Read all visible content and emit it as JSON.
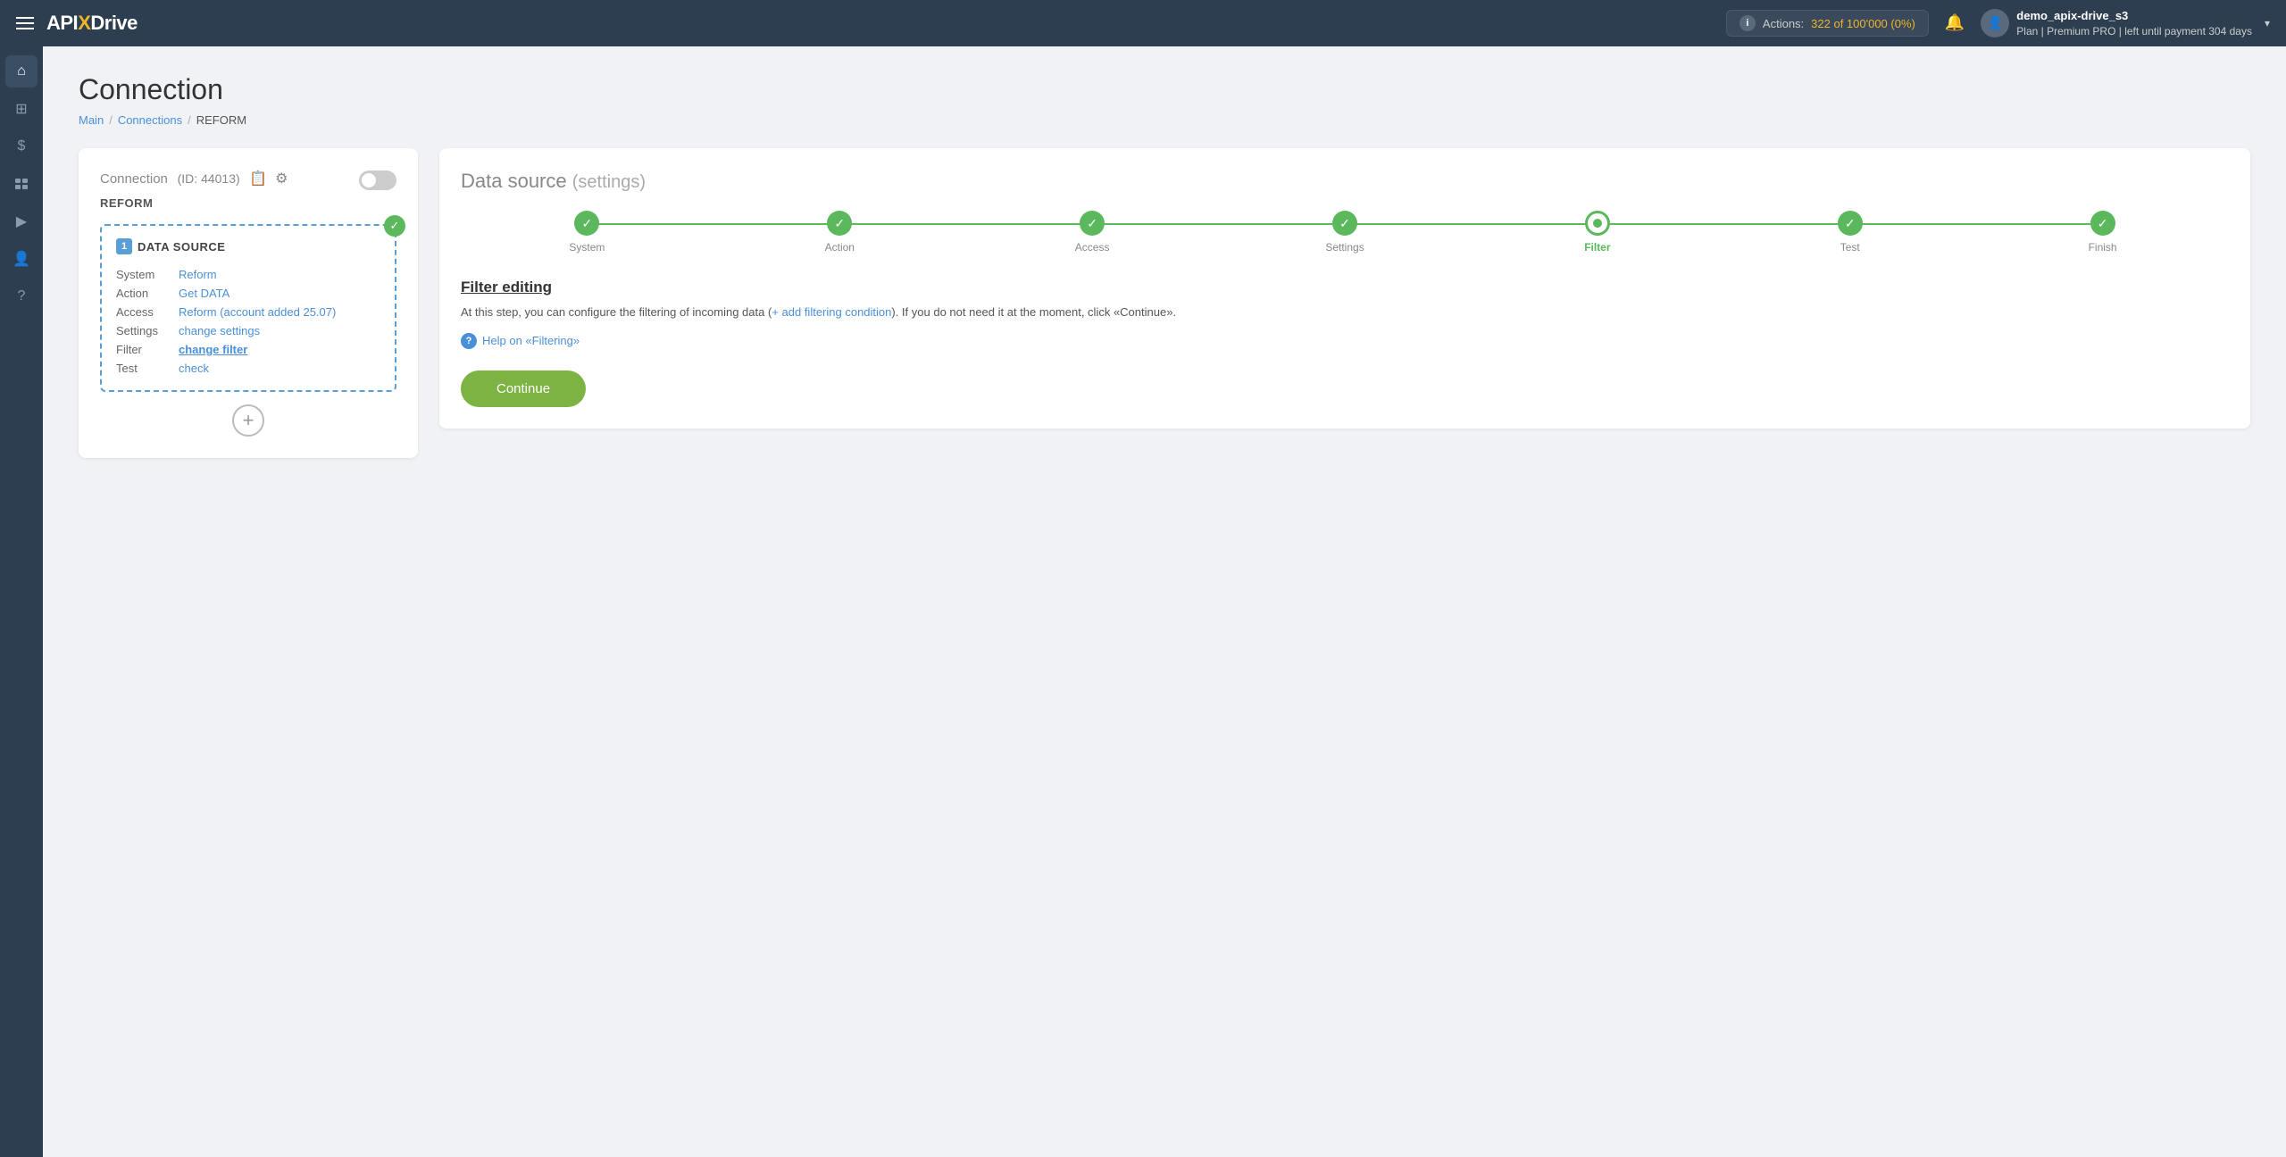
{
  "topnav": {
    "logo": "APIxDrive",
    "logo_api": "API",
    "logo_x": "X",
    "logo_drive": "Drive",
    "actions_label": "Actions:",
    "actions_count": "322 of 100'000 (0%)",
    "bell_title": "Notifications",
    "user_name": "demo_apix-drive_s3",
    "user_plan": "Plan | Premium PRO | left until payment 304 days",
    "chevron": "▾"
  },
  "sidebar": {
    "items": [
      {
        "icon": "⌂",
        "label": "home-icon"
      },
      {
        "icon": "⊞",
        "label": "grid-icon"
      },
      {
        "icon": "$",
        "label": "billing-icon"
      },
      {
        "icon": "✎",
        "label": "edit-icon"
      },
      {
        "icon": "▶",
        "label": "play-icon"
      },
      {
        "icon": "👤",
        "label": "user-icon"
      },
      {
        "icon": "?",
        "label": "help-icon"
      }
    ]
  },
  "page": {
    "title": "Connection",
    "breadcrumb": {
      "main": "Main",
      "connections": "Connections",
      "current": "REFORM"
    }
  },
  "left_card": {
    "header": "Connection",
    "id_text": "(ID: 44013)",
    "connection_name": "REFORM",
    "datasource": {
      "number": "1",
      "label": "DATA SOURCE",
      "rows": [
        {
          "key": "System",
          "value": "Reform",
          "type": "link"
        },
        {
          "key": "Action",
          "value": "Get DATA",
          "type": "link"
        },
        {
          "key": "Access",
          "value": "Reform (account added 25.07)",
          "type": "link"
        },
        {
          "key": "Settings",
          "value": "change settings",
          "type": "link"
        },
        {
          "key": "Filter",
          "value": "change filter",
          "type": "bold-link"
        },
        {
          "key": "Test",
          "value": "check",
          "type": "link"
        }
      ]
    },
    "add_button": "+"
  },
  "right_card": {
    "title": "Data source",
    "title_sub": "(settings)",
    "steps": [
      {
        "label": "System",
        "state": "done"
      },
      {
        "label": "Action",
        "state": "done"
      },
      {
        "label": "Access",
        "state": "done"
      },
      {
        "label": "Settings",
        "state": "done"
      },
      {
        "label": "Filter",
        "state": "active"
      },
      {
        "label": "Test",
        "state": "done"
      },
      {
        "label": "Finish",
        "state": "done"
      }
    ],
    "filter_title": "Filter editing",
    "filter_desc_before": "At this step, you can configure the filtering of incoming data (",
    "filter_desc_add": "+ add filtering condition",
    "filter_desc_after": "). If you do not need it at the moment, click «Continue».",
    "help_text": "Help",
    "help_link": "on «Filtering»",
    "continue_label": "Continue"
  }
}
